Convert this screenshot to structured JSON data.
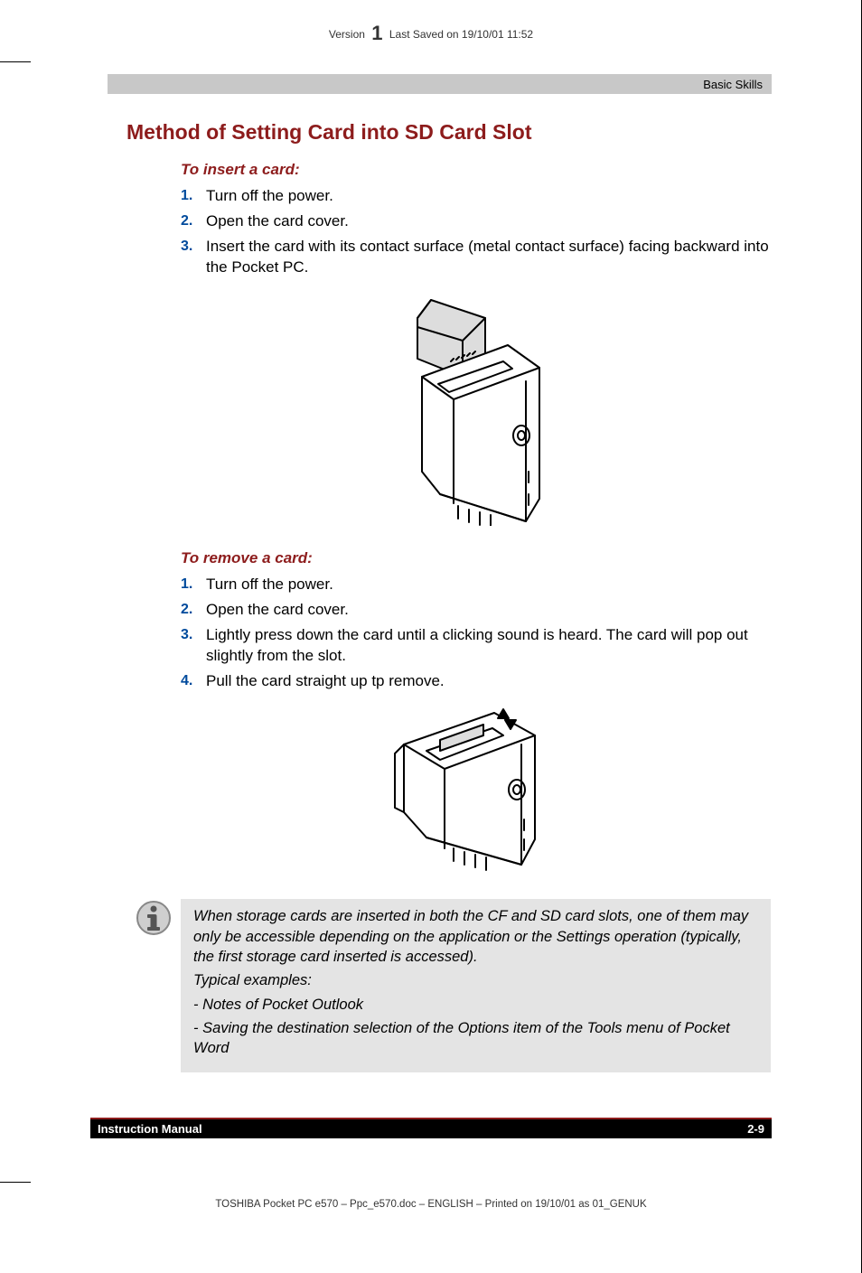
{
  "meta": {
    "version_prefix": "Version",
    "version_num": "1",
    "version_suffix": "Last Saved on 19/10/01 11:52",
    "bottom": "TOSHIBA Pocket PC e570  – Ppc_e570.doc – ENGLISH – Printed on 19/10/01 as 01_GENUK"
  },
  "header": {
    "section": "Basic Skills"
  },
  "title": "Method of Setting Card into SD Card Slot",
  "insert": {
    "heading": "To insert a card:",
    "steps": [
      "Turn off the power.",
      "Open the card cover.",
      "Insert the card with its contact surface (metal contact surface) facing backward into the Pocket PC."
    ]
  },
  "remove": {
    "heading": "To remove a card:",
    "steps": [
      "Turn off the power.",
      "Open the card cover.",
      "Lightly press down the card until a clicking sound is heard. The card will pop out slightly from the slot.",
      "Pull the card straight up tp remove."
    ]
  },
  "note": {
    "p1": "When storage cards are inserted in both the CF and SD card slots, one of them may only be accessible depending on the application or the Settings operation (typically, the first storage card inserted is accessed).",
    "p2": "Typical examples:",
    "p3": "-  Notes of Pocket Outlook",
    "p4": "-  Saving the destination selection of the Options item of the Tools menu of Pocket Word"
  },
  "footer": {
    "left": "Instruction Manual",
    "right": "2-9"
  }
}
